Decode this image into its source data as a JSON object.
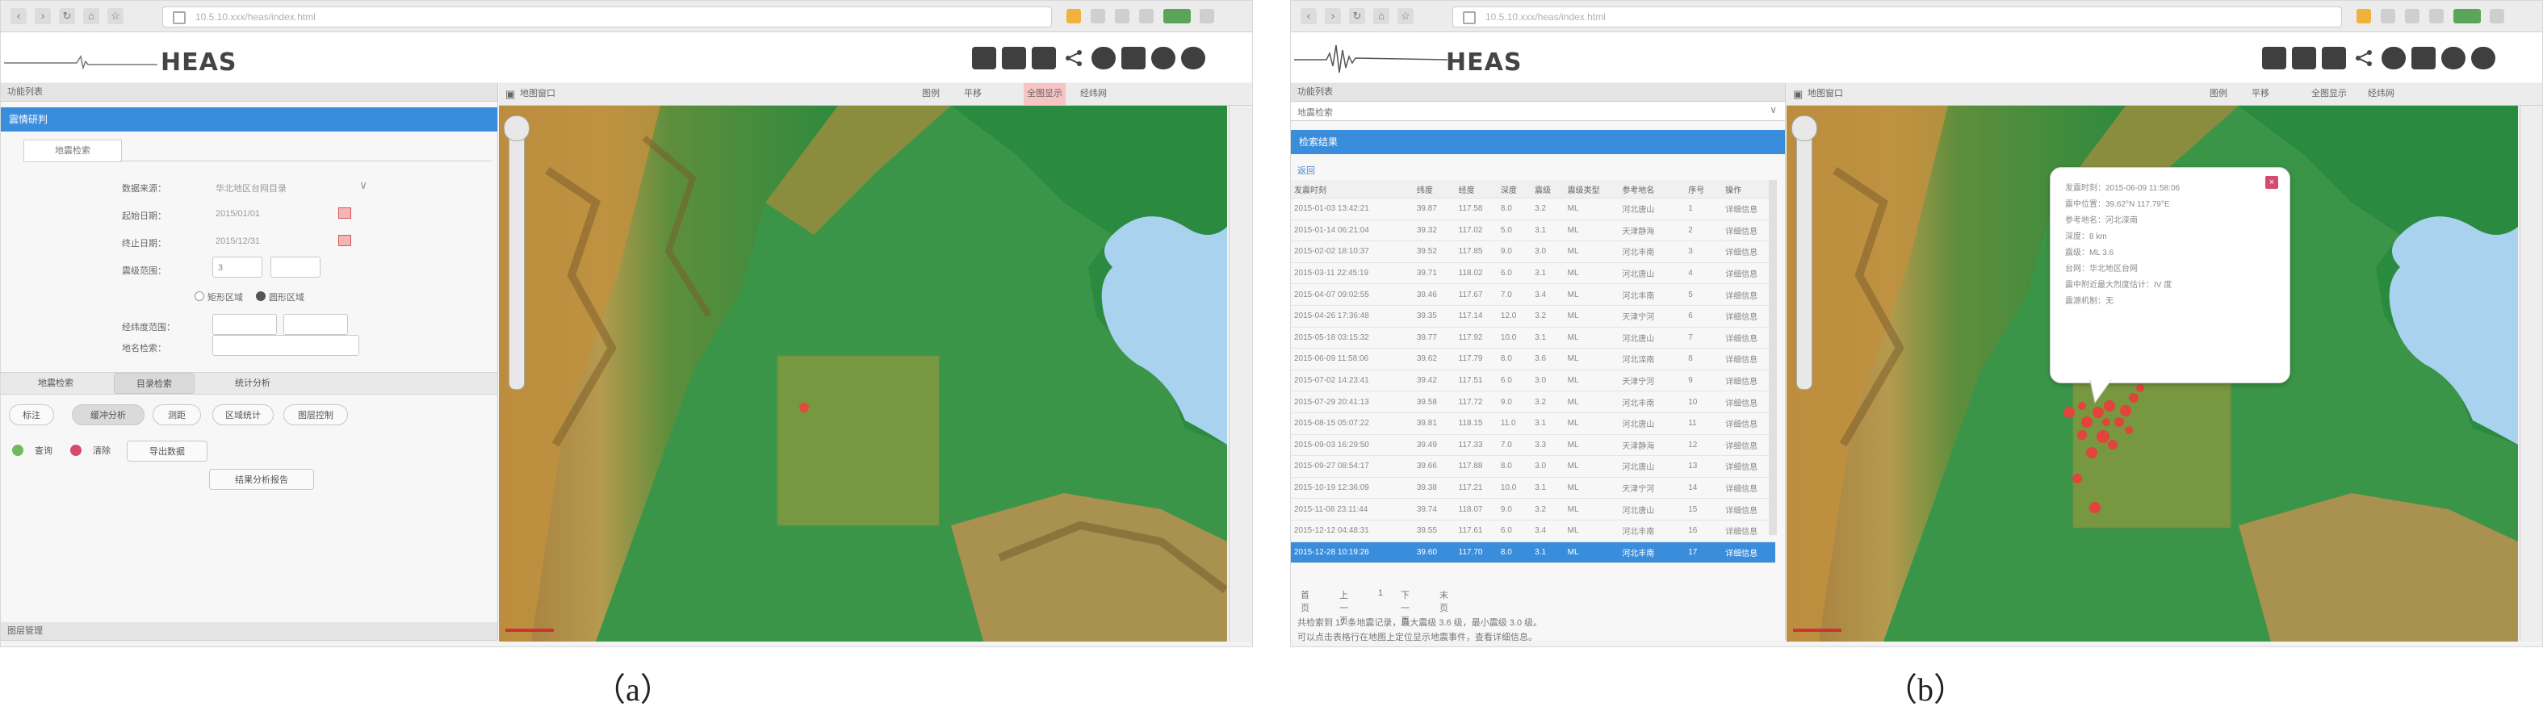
{
  "app": {
    "logo_text": "HEAS",
    "browser_url": "10.5.10.xxx/heas/index.html"
  },
  "panel_a": {
    "sidebar_header": "功能列表",
    "selected_item": "震情研判",
    "tab_label": "地震检索",
    "form": {
      "field1_label": "数据来源：",
      "field1_value": "华北地区台网目录",
      "field2_label": "起始日期：",
      "field2_value": "2015/01/01",
      "field3_label": "终止日期：",
      "field3_value": "2015/12/31",
      "mag_label": "震级范围：",
      "mag_min": "3",
      "radio_a": "矩形区域",
      "radio_b": "圆形区域",
      "lon_label": "经纬度范围：",
      "loc_label": "地名检索："
    },
    "tabs": [
      "地震检索",
      "目录检索",
      "统计分析"
    ],
    "tools": [
      "标注",
      "缓冲分析",
      "测距",
      "区域统计",
      "图层控制"
    ],
    "actions": [
      "查询",
      "清除",
      "导出数据"
    ],
    "center_button": "结果分析报告",
    "bottom_header": "图层管理",
    "map_title": "地图窗口",
    "map_tools": [
      "图例",
      "平移",
      "全图显示",
      "经纬网"
    ]
  },
  "panel_b": {
    "sidebar_header": "功能列表",
    "dropdown_value": "地震检索",
    "selected_item": "检索结果",
    "sublink": "返回",
    "table_headers": [
      "发震时刻",
      "纬度",
      "经度",
      "深度",
      "震级",
      "震级类型",
      "参考地名",
      "序号",
      "操作"
    ],
    "rows": [
      [
        "2015-01-03 13:42:21",
        "39.87",
        "117.58",
        "8.0",
        "3.2",
        "ML",
        "河北唐山",
        "1",
        "详细信息"
      ],
      [
        "2015-01-14 06:21:04",
        "39.32",
        "117.02",
        "5.0",
        "3.1",
        "ML",
        "天津静海",
        "2",
        "详细信息"
      ],
      [
        "2015-02-02 18:10:37",
        "39.52",
        "117.85",
        "9.0",
        "3.0",
        "ML",
        "河北丰南",
        "3",
        "详细信息"
      ],
      [
        "2015-03-11 22:45:19",
        "39.71",
        "118.02",
        "6.0",
        "3.1",
        "ML",
        "河北唐山",
        "4",
        "详细信息"
      ],
      [
        "2015-04-07 09:02:55",
        "39.46",
        "117.67",
        "7.0",
        "3.4",
        "ML",
        "河北丰南",
        "5",
        "详细信息"
      ],
      [
        "2015-04-26 17:36:48",
        "39.35",
        "117.14",
        "12.0",
        "3.2",
        "ML",
        "天津宁河",
        "6",
        "详细信息"
      ],
      [
        "2015-05-18 03:15:32",
        "39.77",
        "117.92",
        "10.0",
        "3.1",
        "ML",
        "河北唐山",
        "7",
        "详细信息"
      ],
      [
        "2015-06-09 11:58:06",
        "39.62",
        "117.79",
        "8.0",
        "3.6",
        "ML",
        "河北滦南",
        "8",
        "详细信息"
      ],
      [
        "2015-07-02 14:23:41",
        "39.42",
        "117.51",
        "6.0",
        "3.0",
        "ML",
        "天津宁河",
        "9",
        "详细信息"
      ],
      [
        "2015-07-29 20:41:13",
        "39.58",
        "117.72",
        "9.0",
        "3.2",
        "ML",
        "河北丰南",
        "10",
        "详细信息"
      ],
      [
        "2015-08-15 05:07:22",
        "39.81",
        "118.15",
        "11.0",
        "3.1",
        "ML",
        "河北唐山",
        "11",
        "详细信息"
      ],
      [
        "2015-09-03 16:29:50",
        "39.49",
        "117.33",
        "7.0",
        "3.3",
        "ML",
        "天津静海",
        "12",
        "详细信息"
      ],
      [
        "2015-09-27 08:54:17",
        "39.66",
        "117.88",
        "8.0",
        "3.0",
        "ML",
        "河北唐山",
        "13",
        "详细信息"
      ],
      [
        "2015-10-19 12:36:09",
        "39.38",
        "117.21",
        "10.0",
        "3.1",
        "ML",
        "天津宁河",
        "14",
        "详细信息"
      ],
      [
        "2015-11-08 23:11:44",
        "39.74",
        "118.07",
        "9.0",
        "3.2",
        "ML",
        "河北唐山",
        "15",
        "详细信息"
      ],
      [
        "2015-12-12 04:48:31",
        "39.55",
        "117.61",
        "6.0",
        "3.4",
        "ML",
        "河北丰南",
        "16",
        "详细信息"
      ]
    ],
    "selected_row": [
      "2015-12-28 10:19:26",
      "39.60",
      "117.70",
      "8.0",
      "3.1",
      "ML",
      "河北丰南",
      "17",
      "详细信息"
    ],
    "pager": [
      "首页",
      "上一页",
      "1",
      "下一页",
      "末页"
    ],
    "summary_line1": "共检索到 17 条地震记录，最大震级 3.6 级，最小震级 3.0 级。",
    "summary_line2": "可以点击表格行在地图上定位显示地震事件，查看详细信息。",
    "map_title": "地图窗口",
    "popup_lines": [
      "发震时刻：2015-06-09 11:58:06",
      "震中位置：39.62°N 117.79°E",
      "参考地名：河北滦南",
      "深度：8 km",
      "震级：ML 3.6",
      "台网：华北地区台网",
      "震中附近最大烈度估计：IV 度",
      "震源机制：无"
    ]
  },
  "captions": {
    "a": "（a）",
    "b": "（b）"
  }
}
